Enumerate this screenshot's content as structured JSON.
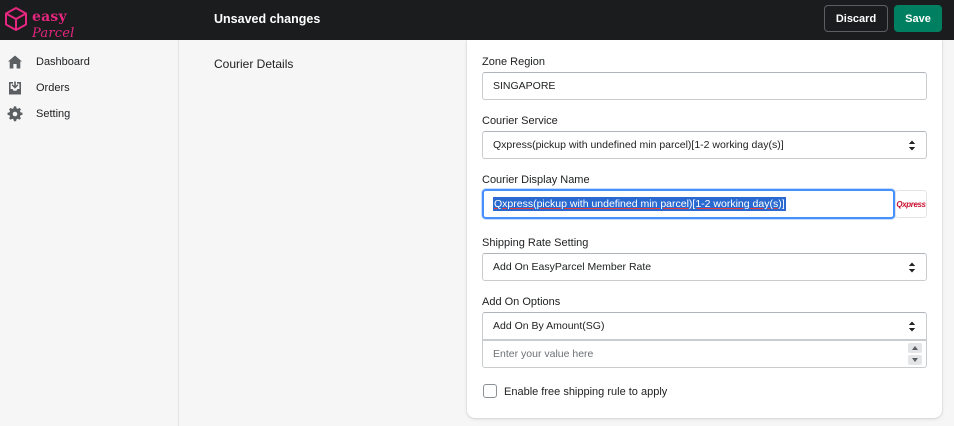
{
  "header": {
    "logo_main": "easy",
    "logo_script": "Parcel",
    "status": "Unsaved changes",
    "discard_label": "Discard",
    "save_label": "Save"
  },
  "sidebar": {
    "items": [
      {
        "label": "Dashboard",
        "icon": "home-icon"
      },
      {
        "label": "Orders",
        "icon": "inbox-download-icon"
      },
      {
        "label": "Setting",
        "icon": "gear-icon"
      }
    ]
  },
  "section": {
    "title": "Courier Details"
  },
  "form": {
    "zone_region": {
      "label": "Zone Region",
      "value": "SINGAPORE"
    },
    "courier_service": {
      "label": "Courier Service",
      "value": "Qxpress(pickup with undefined min parcel)[1-2 working day(s)]"
    },
    "courier_display_name": {
      "label": "Courier Display Name",
      "value": "Qxpress(pickup with undefined min parcel)[1-2 working day(s)]",
      "logo_text": "Qxpress"
    },
    "shipping_rate_setting": {
      "label": "Shipping Rate Setting",
      "value": "Add On EasyParcel Member Rate"
    },
    "add_on_options": {
      "label": "Add On Options",
      "value": "Add On By Amount(SG)"
    },
    "add_on_value": {
      "placeholder": "Enter your value here"
    },
    "free_shipping": {
      "label": "Enable free shipping rule to apply",
      "checked": false
    }
  },
  "colors": {
    "brand": "#e6267f",
    "save_button": "#008060",
    "topbar": "#1a1c1d",
    "focus_ring": "#458fff",
    "selection": "#2a6ad0"
  }
}
